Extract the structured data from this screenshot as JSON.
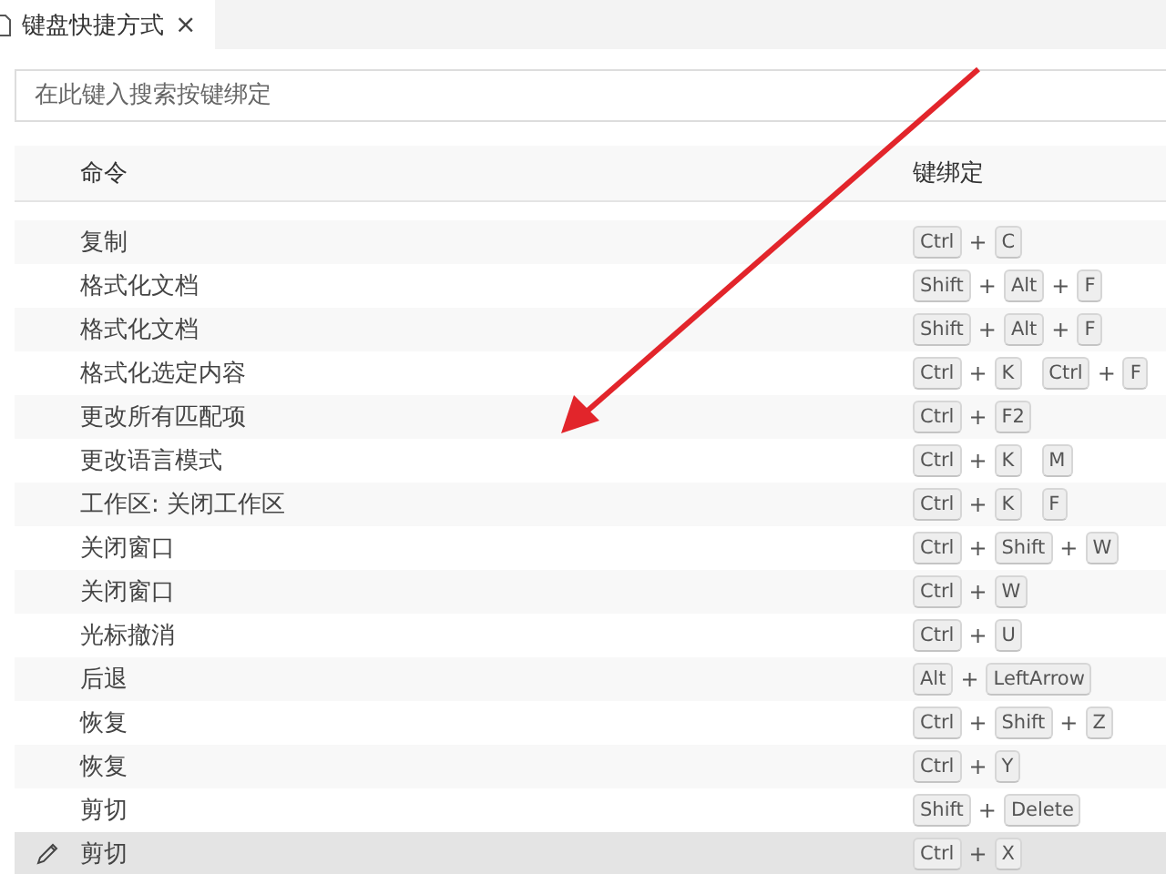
{
  "tab": {
    "title": "键盘快捷方式",
    "close": "×",
    "selected": true
  },
  "search": {
    "placeholder": "在此键入搜索按键绑定"
  },
  "table": {
    "columns": [
      "命令",
      "键绑定"
    ],
    "rows": [
      {
        "command": "复制",
        "selected": false,
        "keys": [
          {
            "kind": "key",
            "label": "Ctrl"
          },
          {
            "kind": "sep",
            "label": "+"
          },
          {
            "kind": "key",
            "label": "C"
          }
        ]
      },
      {
        "command": "格式化文档",
        "selected": false,
        "keys": [
          {
            "kind": "key",
            "label": "Shift"
          },
          {
            "kind": "sep",
            "label": "+"
          },
          {
            "kind": "key",
            "label": "Alt"
          },
          {
            "kind": "sep",
            "label": "+"
          },
          {
            "kind": "key",
            "label": "F"
          }
        ]
      },
      {
        "command": "格式化文档",
        "selected": false,
        "keys": [
          {
            "kind": "key",
            "label": "Shift"
          },
          {
            "kind": "sep",
            "label": "+"
          },
          {
            "kind": "key",
            "label": "Alt"
          },
          {
            "kind": "sep",
            "label": "+"
          },
          {
            "kind": "key",
            "label": "F"
          }
        ]
      },
      {
        "command": "格式化选定内容",
        "selected": false,
        "keys": [
          {
            "kind": "key",
            "label": "Ctrl"
          },
          {
            "kind": "sep",
            "label": "+"
          },
          {
            "kind": "key",
            "label": "K"
          },
          {
            "kind": "space"
          },
          {
            "kind": "key",
            "label": "Ctrl"
          },
          {
            "kind": "sep",
            "label": "+"
          },
          {
            "kind": "key",
            "label": "F"
          }
        ]
      },
      {
        "command": "更改所有匹配项",
        "selected": false,
        "keys": [
          {
            "kind": "key",
            "label": "Ctrl"
          },
          {
            "kind": "sep",
            "label": "+"
          },
          {
            "kind": "key",
            "label": "F2"
          }
        ]
      },
      {
        "command": "更改语言模式",
        "selected": false,
        "keys": [
          {
            "kind": "key",
            "label": "Ctrl"
          },
          {
            "kind": "sep",
            "label": "+"
          },
          {
            "kind": "key",
            "label": "K"
          },
          {
            "kind": "space"
          },
          {
            "kind": "key",
            "label": "M"
          }
        ]
      },
      {
        "command": "工作区: 关闭工作区",
        "selected": false,
        "keys": [
          {
            "kind": "key",
            "label": "Ctrl"
          },
          {
            "kind": "sep",
            "label": "+"
          },
          {
            "kind": "key",
            "label": "K"
          },
          {
            "kind": "space"
          },
          {
            "kind": "key",
            "label": "F"
          }
        ]
      },
      {
        "command": "关闭窗口",
        "selected": false,
        "keys": [
          {
            "kind": "key",
            "label": "Ctrl"
          },
          {
            "kind": "sep",
            "label": "+"
          },
          {
            "kind": "key",
            "label": "Shift"
          },
          {
            "kind": "sep",
            "label": "+"
          },
          {
            "kind": "key",
            "label": "W"
          }
        ]
      },
      {
        "command": "关闭窗口",
        "selected": false,
        "keys": [
          {
            "kind": "key",
            "label": "Ctrl"
          },
          {
            "kind": "sep",
            "label": "+"
          },
          {
            "kind": "key",
            "label": "W"
          }
        ]
      },
      {
        "command": "光标撤消",
        "selected": false,
        "keys": [
          {
            "kind": "key",
            "label": "Ctrl"
          },
          {
            "kind": "sep",
            "label": "+"
          },
          {
            "kind": "key",
            "label": "U"
          }
        ]
      },
      {
        "command": "后退",
        "selected": false,
        "keys": [
          {
            "kind": "key",
            "label": "Alt"
          },
          {
            "kind": "sep",
            "label": "+"
          },
          {
            "kind": "key",
            "label": "LeftArrow"
          }
        ]
      },
      {
        "command": "恢复",
        "selected": false,
        "keys": [
          {
            "kind": "key",
            "label": "Ctrl"
          },
          {
            "kind": "sep",
            "label": "+"
          },
          {
            "kind": "key",
            "label": "Shift"
          },
          {
            "kind": "sep",
            "label": "+"
          },
          {
            "kind": "key",
            "label": "Z"
          }
        ]
      },
      {
        "command": "恢复",
        "selected": false,
        "keys": [
          {
            "kind": "key",
            "label": "Ctrl"
          },
          {
            "kind": "sep",
            "label": "+"
          },
          {
            "kind": "key",
            "label": "Y"
          }
        ]
      },
      {
        "command": "剪切",
        "selected": false,
        "keys": [
          {
            "kind": "key",
            "label": "Shift"
          },
          {
            "kind": "sep",
            "label": "+"
          },
          {
            "kind": "key",
            "label": "Delete"
          }
        ]
      },
      {
        "command": "剪切",
        "selected": true,
        "keys": [
          {
            "kind": "key",
            "label": "Ctrl"
          },
          {
            "kind": "sep",
            "label": "+"
          },
          {
            "kind": "key",
            "label": "X"
          }
        ]
      }
    ]
  }
}
